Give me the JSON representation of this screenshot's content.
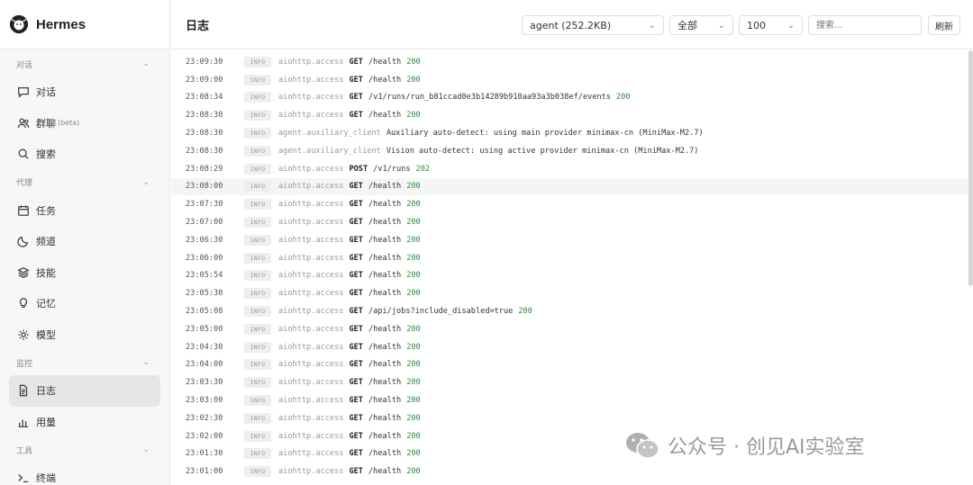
{
  "brand": {
    "name": "Hermes"
  },
  "sidebar": {
    "sections": [
      {
        "label": "对话",
        "items": [
          {
            "label": "对话",
            "icon": "chat-icon"
          },
          {
            "label": "群聊",
            "badge": "(beta)",
            "icon": "group-icon"
          },
          {
            "label": "搜索",
            "icon": "search-icon"
          }
        ]
      },
      {
        "label": "代理",
        "items": [
          {
            "label": "任务",
            "icon": "calendar-icon"
          },
          {
            "label": "频道",
            "icon": "moon-icon"
          },
          {
            "label": "技能",
            "icon": "layers-icon"
          },
          {
            "label": "记忆",
            "icon": "bulb-icon"
          },
          {
            "label": "模型",
            "icon": "sun-icon"
          }
        ]
      },
      {
        "label": "监控",
        "items": [
          {
            "label": "日志",
            "icon": "document-icon",
            "active": true
          },
          {
            "label": "用量",
            "icon": "bar-chart-icon"
          }
        ]
      },
      {
        "label": "工具",
        "items": [
          {
            "label": "终端",
            "icon": "terminal-icon"
          }
        ]
      }
    ]
  },
  "header": {
    "title": "日志",
    "file_select": "agent (252.2KB)",
    "level_select": "全部",
    "limit_select": "100",
    "search_placeholder": "搜索...",
    "refresh_label": "刷新"
  },
  "logs": [
    {
      "time": "23:09:30",
      "level": "INFO",
      "source": "aiohttp.access",
      "method": "GET",
      "path": "/health",
      "status": "200"
    },
    {
      "time": "23:09:00",
      "level": "INFO",
      "source": "aiohttp.access",
      "method": "GET",
      "path": "/health",
      "status": "200"
    },
    {
      "time": "23:08:34",
      "level": "INFO",
      "source": "aiohttp.access",
      "method": "GET",
      "path": "/v1/runs/run_b81ccad0e3b14289b910aa93a3b038ef/events",
      "status": "200"
    },
    {
      "time": "23:08:30",
      "level": "INFO",
      "source": "aiohttp.access",
      "method": "GET",
      "path": "/health",
      "status": "200"
    },
    {
      "time": "23:08:30",
      "level": "INFO",
      "source": "agent.auxiliary_client",
      "message": "Auxiliary auto-detect: using main provider minimax-cn (MiniMax-M2.7)"
    },
    {
      "time": "23:08:30",
      "level": "INFO",
      "source": "agent.auxiliary_client",
      "message": "Vision auto-detect: using active provider minimax-cn (MiniMax-M2.7)"
    },
    {
      "time": "23:08:29",
      "level": "INFO",
      "source": "aiohttp.access",
      "method": "POST",
      "path": "/v1/runs",
      "status": "202"
    },
    {
      "time": "23:08:00",
      "level": "INFO",
      "source": "aiohttp.access",
      "method": "GET",
      "path": "/health",
      "status": "200",
      "highlight": true
    },
    {
      "time": "23:07:30",
      "level": "INFO",
      "source": "aiohttp.access",
      "method": "GET",
      "path": "/health",
      "status": "200"
    },
    {
      "time": "23:07:00",
      "level": "INFO",
      "source": "aiohttp.access",
      "method": "GET",
      "path": "/health",
      "status": "200"
    },
    {
      "time": "23:06:30",
      "level": "INFO",
      "source": "aiohttp.access",
      "method": "GET",
      "path": "/health",
      "status": "200"
    },
    {
      "time": "23:06:00",
      "level": "INFO",
      "source": "aiohttp.access",
      "method": "GET",
      "path": "/health",
      "status": "200"
    },
    {
      "time": "23:05:54",
      "level": "INFO",
      "source": "aiohttp.access",
      "method": "GET",
      "path": "/health",
      "status": "200"
    },
    {
      "time": "23:05:30",
      "level": "INFO",
      "source": "aiohttp.access",
      "method": "GET",
      "path": "/health",
      "status": "200"
    },
    {
      "time": "23:05:08",
      "level": "INFO",
      "source": "aiohttp.access",
      "method": "GET",
      "path": "/api/jobs?include_disabled=true",
      "status": "200"
    },
    {
      "time": "23:05:00",
      "level": "INFO",
      "source": "aiohttp.access",
      "method": "GET",
      "path": "/health",
      "status": "200"
    },
    {
      "time": "23:04:30",
      "level": "INFO",
      "source": "aiohttp.access",
      "method": "GET",
      "path": "/health",
      "status": "200"
    },
    {
      "time": "23:04:00",
      "level": "INFO",
      "source": "aiohttp.access",
      "method": "GET",
      "path": "/health",
      "status": "200"
    },
    {
      "time": "23:03:30",
      "level": "INFO",
      "source": "aiohttp.access",
      "method": "GET",
      "path": "/health",
      "status": "200"
    },
    {
      "time": "23:03:00",
      "level": "INFO",
      "source": "aiohttp.access",
      "method": "GET",
      "path": "/health",
      "status": "200"
    },
    {
      "time": "23:02:30",
      "level": "INFO",
      "source": "aiohttp.access",
      "method": "GET",
      "path": "/health",
      "status": "200"
    },
    {
      "time": "23:02:00",
      "level": "INFO",
      "source": "aiohttp.access",
      "method": "GET",
      "path": "/health",
      "status": "200"
    },
    {
      "time": "23:01:30",
      "level": "INFO",
      "source": "aiohttp.access",
      "method": "GET",
      "path": "/health",
      "status": "200"
    },
    {
      "time": "23:01:00",
      "level": "INFO",
      "source": "aiohttp.access",
      "method": "GET",
      "path": "/health",
      "status": "200"
    }
  ],
  "watermark": {
    "text": "公众号 · 创见AI实验室"
  },
  "colors": {
    "status_ok": "#2e8b3a",
    "active_bg": "#e6e6e6",
    "sidebar_bg": "#f7f7f7"
  }
}
